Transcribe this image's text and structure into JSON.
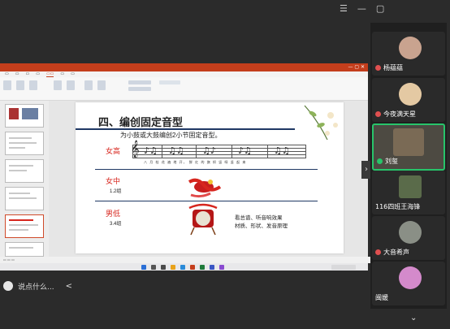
{
  "meeting": {
    "participants": [
      {
        "name": "杨蕴蕴"
      },
      {
        "name": "今夜满天星"
      },
      {
        "name": "刘玺"
      },
      {
        "name": "116四班王海锋"
      },
      {
        "name": "大音希声"
      },
      {
        "name": "闽媛"
      }
    ],
    "chat_placeholder": "说点什么...",
    "chat_toggle": "<"
  },
  "ppt": {
    "slide": {
      "title": "四、编创固定音型",
      "subtitle": "为小鼓或大鼓编创2小节固定音型。",
      "row1_label": "女高",
      "row2_label": "女中",
      "row2_group": "1.2组",
      "row3_label": "男低",
      "row3_group": "3.4组",
      "lyrics": "八 月 桂 花 遍 地 开，   鲜 红 的 旗 帜 竖 呀 竖 起 来",
      "note_line1": "看总谱、听音响效果",
      "note_line2": "材质、形状、发音原理"
    }
  }
}
